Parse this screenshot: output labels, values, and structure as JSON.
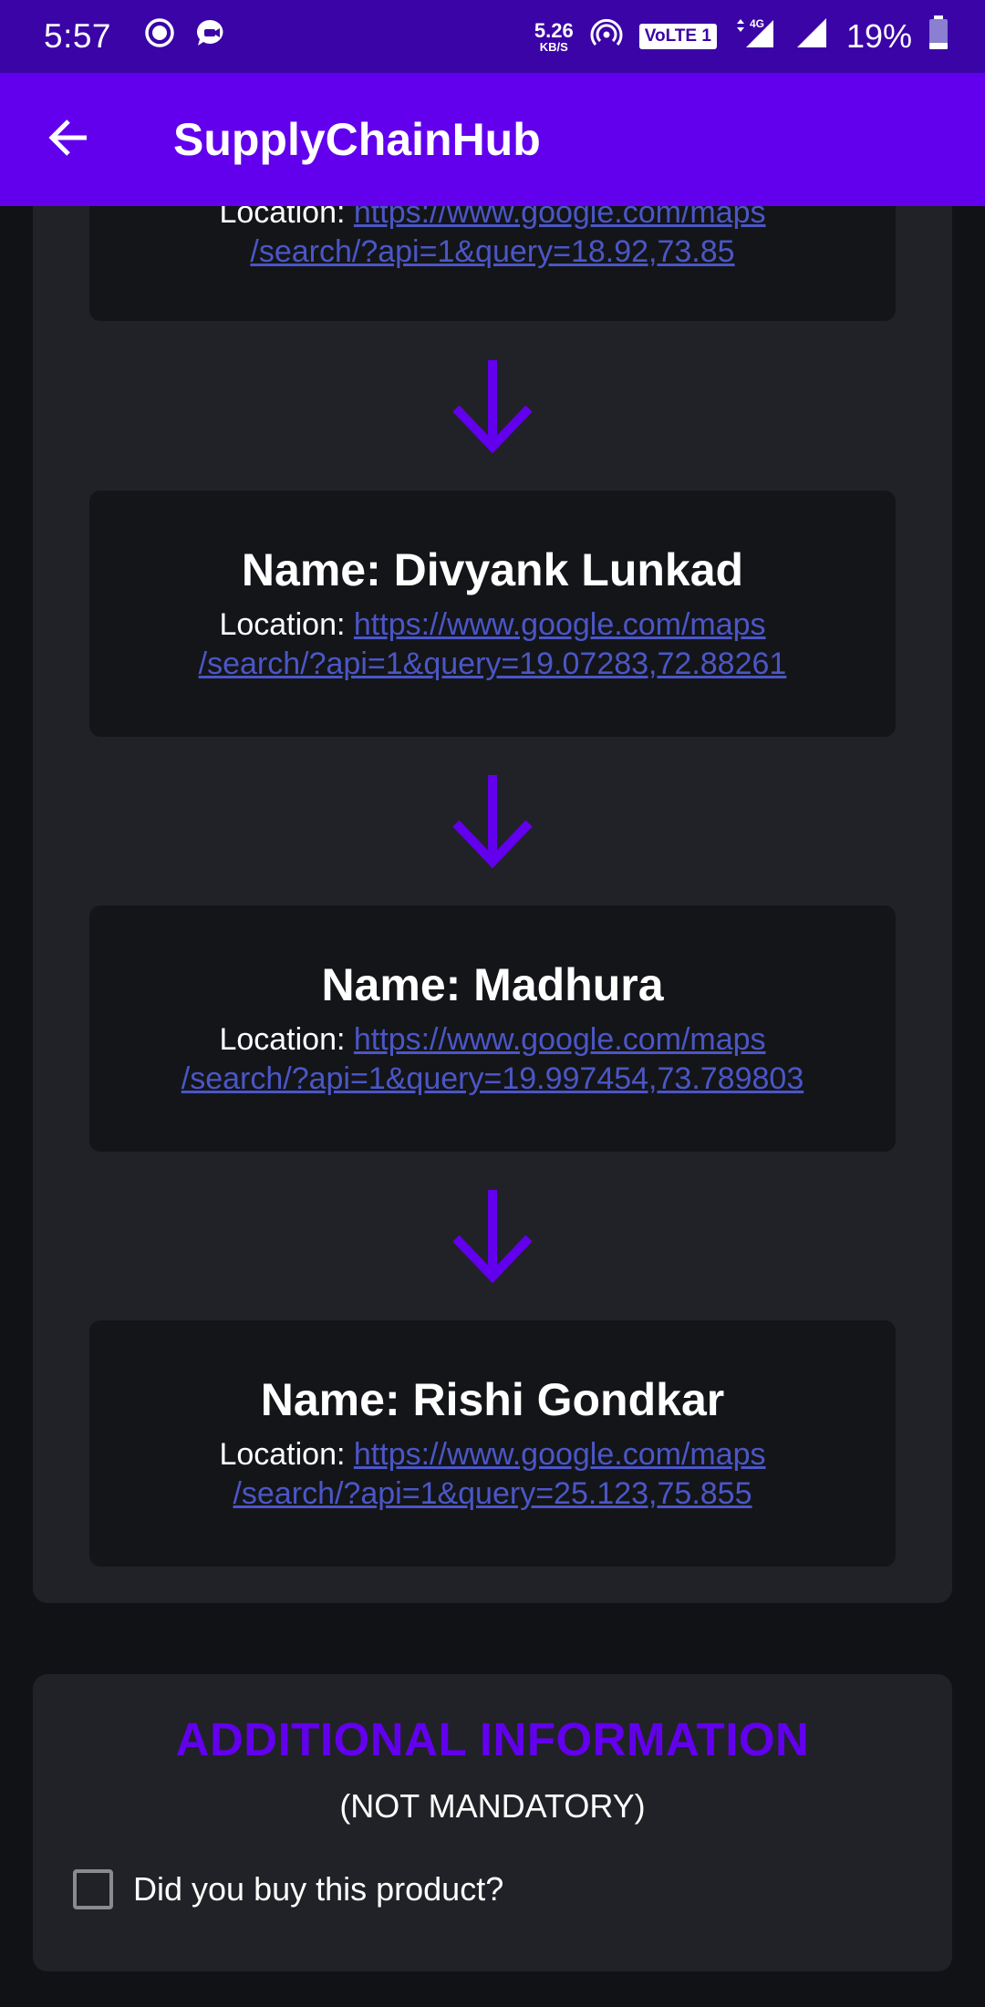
{
  "status_bar": {
    "time": "5:57",
    "speed_value": "5.26",
    "speed_unit": "KB/S",
    "volte": "VoLTE 1",
    "network": "4G",
    "battery": "19%"
  },
  "app_bar": {
    "title": "SupplyChainHub"
  },
  "chain": {
    "location_label": "Location: ",
    "name_prefix": "Name: ",
    "nodes": [
      {
        "name": "",
        "link_line1": "https://www.google.com/maps",
        "link_line2": "/search/?api=1&query=18.92,73.85"
      },
      {
        "name": "Name: Divyank Lunkad",
        "link_line1": "https://www.google.com/maps",
        "link_line2": "/search/?api=1&query=19.07283,72.88261"
      },
      {
        "name": "Name: Madhura",
        "link_line1": "https://www.google.com/maps",
        "link_line2": "/search/?api=1&query=19.997454,73.789803"
      },
      {
        "name": "Name: Rishi Gondkar",
        "link_line1": "https://www.google.com/maps",
        "link_line2": "/search/?api=1&query=25.123,75.855"
      }
    ]
  },
  "additional": {
    "title": "ADDITIONAL INFORMATION",
    "subtitle": "(NOT MANDATORY)",
    "checkbox_label": "Did you buy this product?",
    "checked": false
  },
  "colors": {
    "accent": "#6200ee",
    "link": "#4b56c6",
    "panel": "#212227",
    "card": "#141519"
  }
}
